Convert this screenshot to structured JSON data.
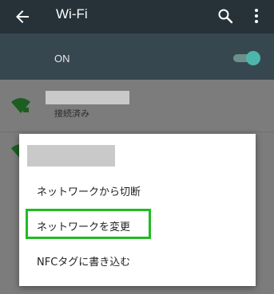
{
  "app_bar": {
    "title": "Wi-Fi",
    "back_icon": "arrow-back-icon",
    "search_icon": "search-icon",
    "more_icon": "more-vert-icon",
    "background": "#263238"
  },
  "master_switch": {
    "label": "ON",
    "checked": true,
    "accent": "#4db6ac"
  },
  "networks": [
    {
      "status": "接続済み",
      "icon": "wifi-signal-locked-icon",
      "icon_color": "#1b5e20"
    },
    {
      "icon": "wifi-signal-locked-icon"
    }
  ],
  "dialog": {
    "menu_items": [
      {
        "label": "ネットワークから切断"
      },
      {
        "label": "ネットワークを変更",
        "highlighted": true
      },
      {
        "label": "NFCタグに書き込む"
      }
    ],
    "highlight_color": "#22bb22"
  }
}
